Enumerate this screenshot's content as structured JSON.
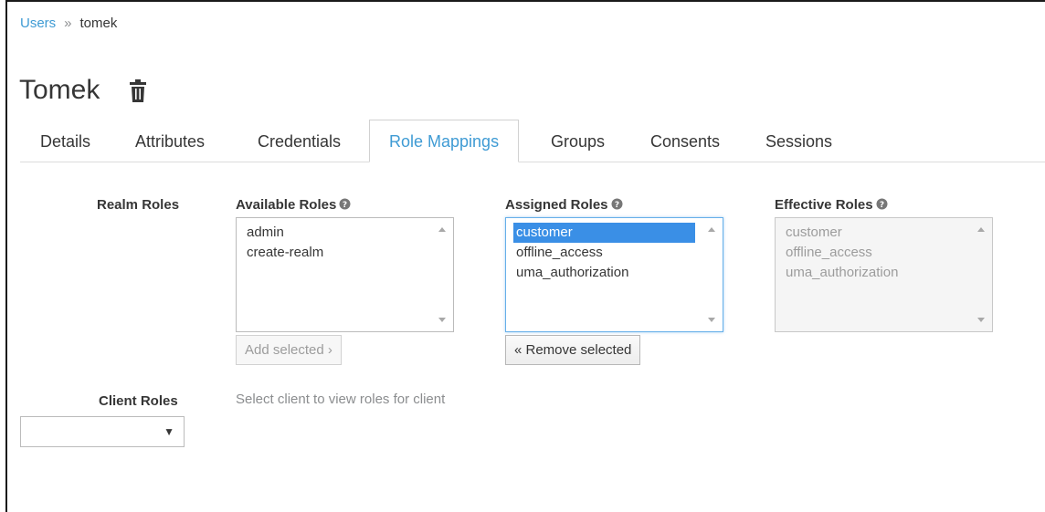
{
  "breadcrumb": {
    "parent": "Users",
    "separator": "»",
    "current": "tomek"
  },
  "page": {
    "title": "Tomek"
  },
  "tabs": [
    {
      "label": "Details"
    },
    {
      "label": "Attributes"
    },
    {
      "label": "Credentials"
    },
    {
      "label": "Role Mappings",
      "active": true
    },
    {
      "label": "Groups"
    },
    {
      "label": "Consents"
    },
    {
      "label": "Sessions"
    }
  ],
  "realm_roles": {
    "label": "Realm Roles",
    "available": {
      "label": "Available Roles",
      "items": [
        "admin",
        "create-realm"
      ],
      "button": "Add selected ›"
    },
    "assigned": {
      "label": "Assigned Roles",
      "items": [
        "customer",
        "offline_access",
        "uma_authorization"
      ],
      "selected": "customer",
      "button": "« Remove selected"
    },
    "effective": {
      "label": "Effective Roles",
      "items": [
        "customer",
        "offline_access",
        "uma_authorization"
      ]
    }
  },
  "client_roles": {
    "label": "Client Roles",
    "hint": "Select client to view roles for client",
    "select_value": ""
  },
  "colors": {
    "link": "#3f9bd4",
    "selection": "#3a8fe6"
  },
  "icons": {
    "delete": "trash-icon",
    "help": "question-circle-icon"
  }
}
